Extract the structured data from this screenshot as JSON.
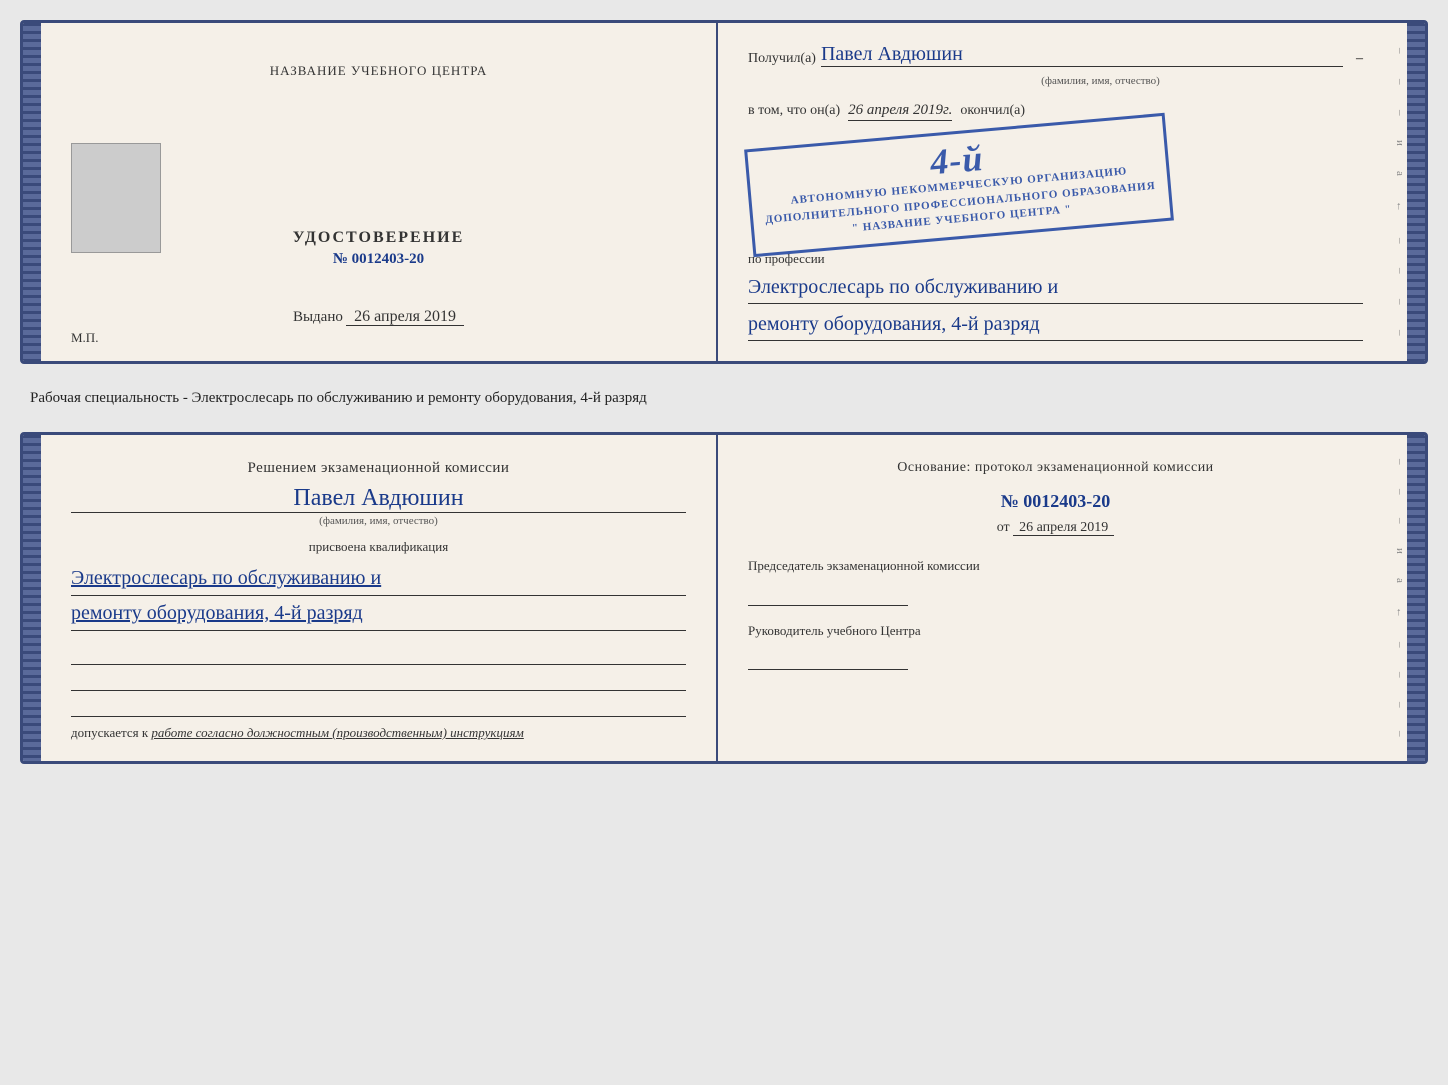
{
  "top_booklet": {
    "left": {
      "title": "НАЗВАНИЕ УЧЕБНОГО ЦЕНТРА",
      "cert_title": "УДОСТОВЕРЕНИЕ",
      "cert_number": "№ 0012403-20",
      "issued_label": "Выдано",
      "issued_date": "26 апреля 2019",
      "mp_label": "М.П."
    },
    "right": {
      "received_label": "Получил(а)",
      "person_name": "Павел Авдюшин",
      "fio_sub": "(фамилия, имя, отчество)",
      "vtom_label": "в том, что он(а)",
      "date_value": "26 апреля 2019г.",
      "finished_label": "окончил(а)",
      "grade_big": "4-й",
      "org_line1": "АВТОНОМНУЮ НЕКОММЕРЧЕСКУЮ ОРГАНИЗАЦИЮ",
      "org_line2": "ДОПОЛНИТЕЛЬНОГО ПРОФЕССИОНАЛЬНОГО ОБРАЗОВАНИЯ",
      "org_line3": "\" НАЗВАНИЕ УЧЕБНОГО ЦЕНТРА \"",
      "profession_label": "по профессии",
      "profession_value1": "Электрослесарь по обслуживанию и",
      "profession_value2": "ремонту оборудования, 4-й разряд"
    }
  },
  "middle_text": {
    "label": "Рабочая специальность - Электрослесарь по обслуживанию и ремонту оборудования, 4-й разряд"
  },
  "bottom_booklet": {
    "left": {
      "decision_title": "Решением экзаменационной комиссии",
      "person_name": "Павел Авдюшин",
      "fio_sub": "(фамилия, имя, отчество)",
      "assigned_label": "присвоена квалификация",
      "qual_value1": "Электрослесарь по обслуживанию и",
      "qual_value2": "ремонту оборудования, 4-й разряд",
      "allowed_label": "допускается к",
      "allowed_value": "работе согласно должностным (производственным) инструкциям"
    },
    "right": {
      "osnov_label": "Основание: протокол экзаменационной комиссии",
      "proto_number": "№ 0012403-20",
      "proto_date_prefix": "от",
      "proto_date": "26 апреля 2019",
      "chairman_label": "Председатель экзаменационной комиссии",
      "head_label": "Руководитель учебного Центра"
    }
  },
  "deco": {
    "items": [
      "и",
      "а",
      "←",
      "–",
      "–",
      "–"
    ]
  }
}
